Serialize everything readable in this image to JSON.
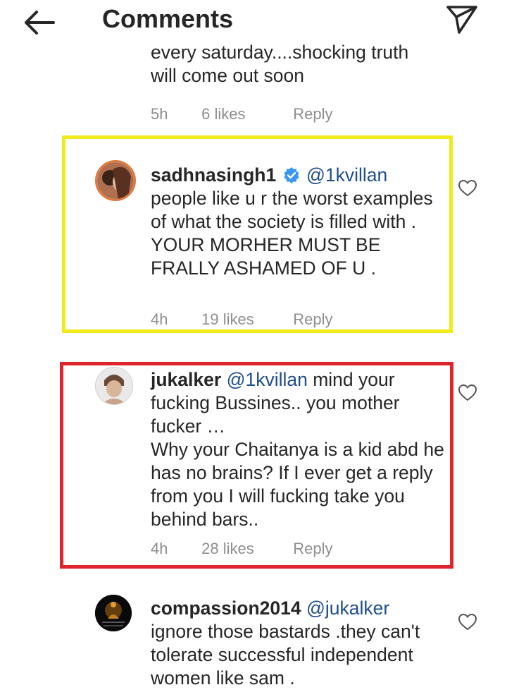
{
  "header": {
    "title": "Comments"
  },
  "comments": [
    {
      "text_lines": [
        "every saturday....shocking truth",
        "will come out soon"
      ],
      "time": "5h",
      "likes": "6 likes",
      "reply": "Reply"
    },
    {
      "username": "sadhnasingh1",
      "verified": true,
      "mention": "@1kvillan",
      "text": "people like u r the worst examples of what the society is filled with . YOUR MORHER MUST BE FRALLY ASHAMED OF U .",
      "time": "4h",
      "likes": "19 likes",
      "reply": "Reply"
    },
    {
      "username": "jukalker",
      "mention": "@1kvillan",
      "text": "mind your fucking Bussines.. you mother fucker …",
      "text2": "Why your Chaitanya is a kid abd he has no brains? If I ever get a reply from you I will fucking take you behind bars..",
      "time": "4h",
      "likes": "28 likes",
      "reply": "Reply"
    },
    {
      "username": "compassion2014",
      "mention": "@jukalker",
      "text": "ignore those bastards .they can't tolerate successful independent women like sam ."
    }
  ],
  "colors": {
    "highlight_yellow": "#f3ea1c",
    "highlight_red": "#e0242b",
    "mention_blue": "#1f4e8c",
    "verified_blue": "#3897f0",
    "meta_gray": "#8e8e8e"
  },
  "icons": {
    "back": "arrow-left-icon",
    "send": "paper-plane-icon",
    "like": "heart-outline-icon",
    "verified": "verified-badge-icon"
  }
}
